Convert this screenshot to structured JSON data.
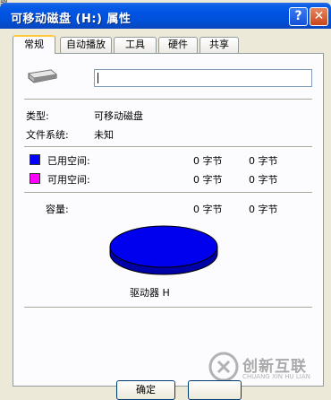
{
  "desktop_fragment": "驱",
  "window": {
    "title": "可移动磁盘 (H:) 属性",
    "help_glyph": "?",
    "close_glyph": "✕"
  },
  "tabs": [
    {
      "label": "常规",
      "active": true
    },
    {
      "label": "自动播放",
      "active": false
    },
    {
      "label": "工具",
      "active": false
    },
    {
      "label": "硬件",
      "active": false
    },
    {
      "label": "共享",
      "active": false
    }
  ],
  "general": {
    "name_value": "",
    "type_label": "类型:",
    "type_value": "可移动磁盘",
    "fs_label": "文件系统:",
    "fs_value": "未知",
    "used": {
      "label": "已用空间:",
      "bytes": "0 字节",
      "size": "0 字节",
      "color": "#0000FF"
    },
    "free": {
      "label": "可用空间:",
      "bytes": "0 字节",
      "size": "0 字节",
      "color": "#FF00FF"
    },
    "capacity": {
      "label": "容量:",
      "bytes": "0 字节",
      "size": "0 字节"
    },
    "pie_color": "#0000EE",
    "drive_label": "驱动器 H"
  },
  "buttons": {
    "ok_label": "确定"
  },
  "watermark": {
    "text": "创新互联",
    "sub": "CHUANG XIN HU LIAN"
  }
}
